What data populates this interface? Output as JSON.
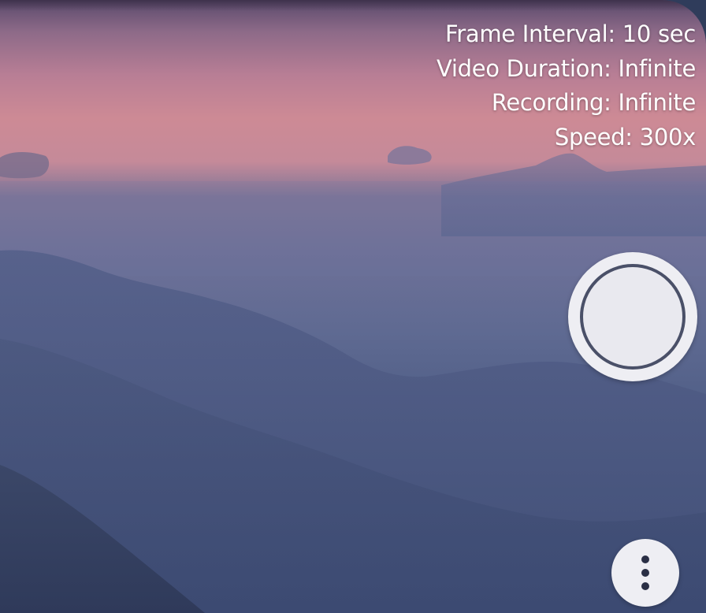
{
  "overlay": {
    "frame_interval": "Frame Interval: 10 sec",
    "video_duration": "Video Duration: Infinite",
    "recording": "Recording: Infinite",
    "speed": "Speed: 300x"
  },
  "controls": {
    "shutter_icon": "record-circle-icon",
    "menu_icon": "more-vert-icon"
  },
  "colors": {
    "sky_top": "#5a4a6c",
    "sky_glow": "#cd8a95",
    "haze": "#6e7198",
    "mountains": "#3d4c72",
    "button_fill": "#eeeef3",
    "button_ring": "#4a5068"
  }
}
